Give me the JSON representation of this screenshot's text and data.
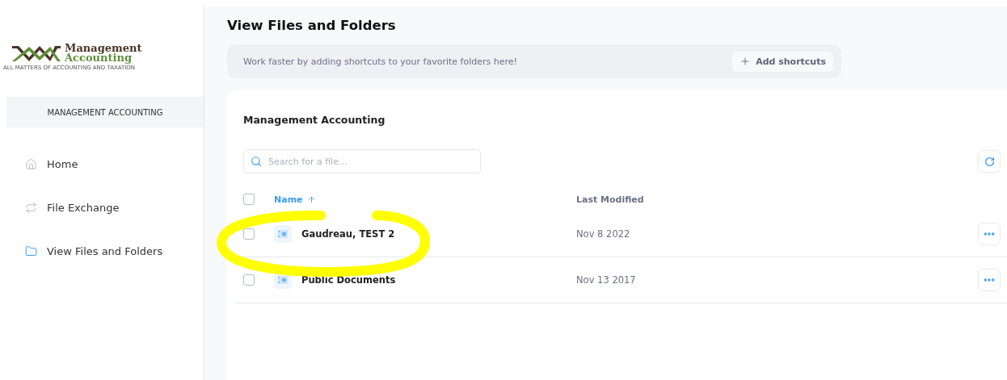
{
  "logo": {
    "line_1": "Management",
    "line_2": "Accounting",
    "tagline": "ALL MATTERS OF ACCOUNTING AND TAXATION"
  },
  "sidebar": {
    "account": "MANAGEMENT ACCOUNTING",
    "items": [
      {
        "label": "Home",
        "selected": false
      },
      {
        "label": "File Exchange",
        "selected": false
      },
      {
        "label": "View Files and Folders",
        "selected": true
      }
    ]
  },
  "page_title": "View Files and Folders",
  "shortcuts": {
    "message": "Work faster by adding shortcuts to your favorite folders here!",
    "button": "Add shortcuts"
  },
  "panel": {
    "title": "Management Accounting",
    "search": {
      "placeholder": "Search for a file..."
    },
    "table": {
      "all_checked": false,
      "columns": [
        {
          "label": "Name",
          "sorted": true
        },
        {
          "label": "Last Modified",
          "sorted": false
        }
      ],
      "rows": [
        {
          "name": "Gaudreau, TEST 2",
          "modified": "Nov 8 2022",
          "checked": false,
          "circled": true
        },
        {
          "name": "Public Documents",
          "modified": "Nov 13 2017",
          "checked": false,
          "circled": false
        }
      ]
    }
  }
}
